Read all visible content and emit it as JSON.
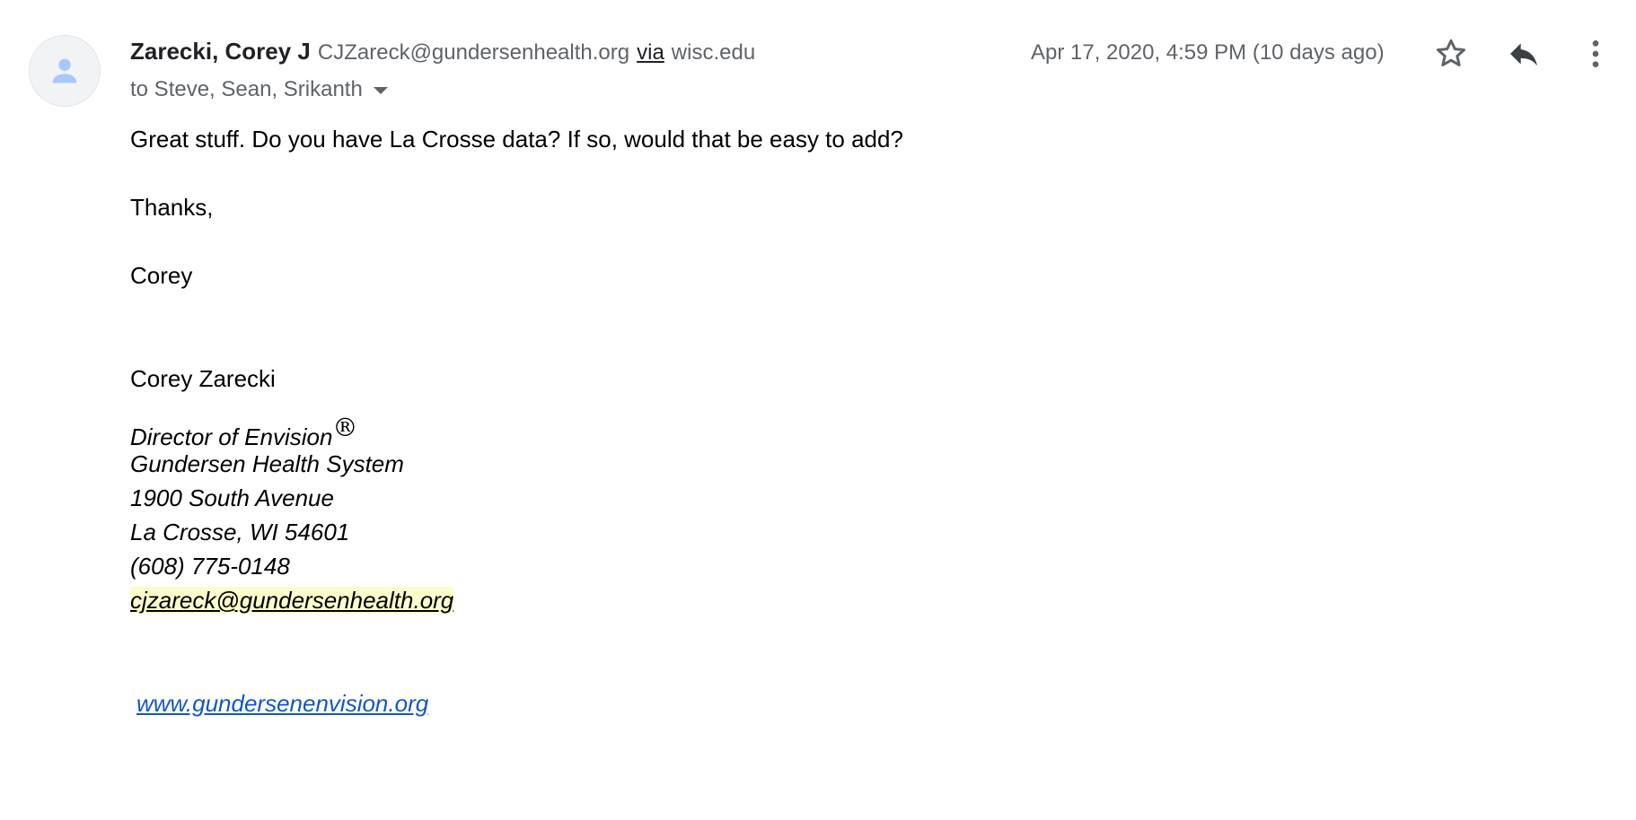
{
  "message": {
    "sender_name": "Zarecki, Corey J",
    "sender_email": "CJZareck@gundersenhealth.org",
    "via_label": "via",
    "via_domain": "wisc.edu",
    "recipients": "to Steve, Sean, Srikanth",
    "timestamp": "Apr 17, 2020, 4:59 PM (10 days ago)",
    "avatar_icon": "person-icon",
    "actions": {
      "star_icon": "star-icon",
      "reply_icon": "reply-icon",
      "more_icon": "more-vert-icon"
    },
    "body": {
      "line1": "Great stuff.  Do you have La Crosse data?  If so, would that be easy to add?",
      "thanks": "Thanks,",
      "signoff": "Corey"
    },
    "signature": {
      "name": "Corey Zarecki",
      "title": "Director of Envision",
      "registered_mark": "®",
      "organization": "Gundersen Health System",
      "address1": "1900 South Avenue",
      "address2": "La Crosse, WI 54601",
      "phone": "(608) 775-0148",
      "email": "cjzareck@gundersenhealth.org",
      "website": "www.gundersenenvision.org"
    }
  },
  "colors": {
    "text_primary": "#202124",
    "text_secondary": "#5f6368",
    "link": "#1155cc",
    "highlight": "#fdfccc",
    "avatar_bg": "#f1f3f4",
    "avatar_icon": "#a8c7fa"
  }
}
